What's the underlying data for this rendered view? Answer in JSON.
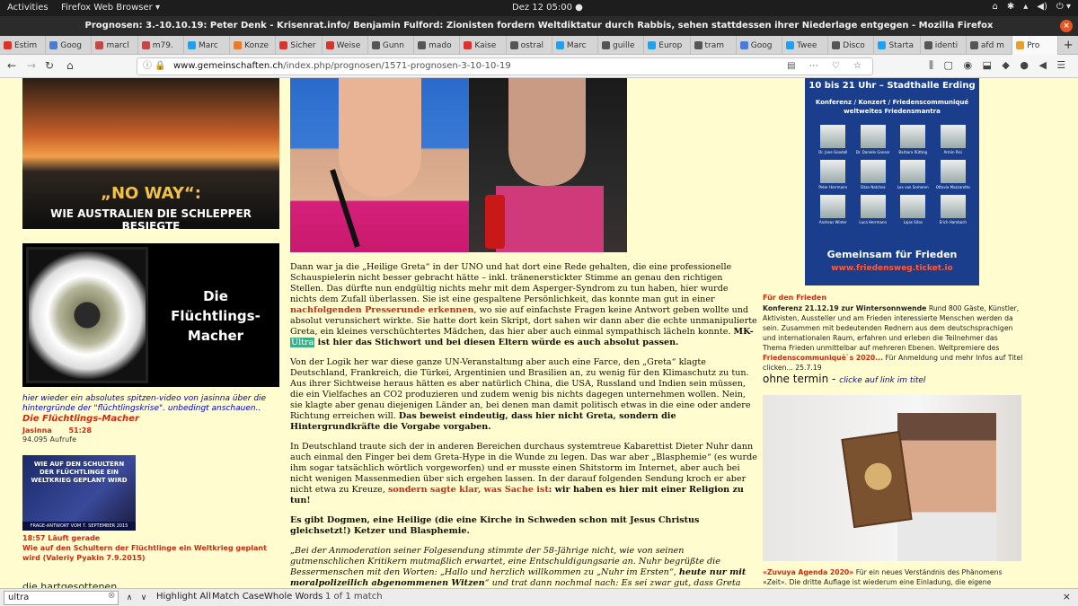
{
  "topbar": {
    "activities": "Activities",
    "app": "Firefox Web Browser ▾",
    "clock": "Dez 12  05:00 ●",
    "tray": [
      "⌂",
      "✱",
      "▴",
      "◀)",
      "⏻ ▾"
    ]
  },
  "window": {
    "title": "Prognosen: 3.-10.10.19: Peter Denk - Krisenrat.info/ Benjamin Fulford: Zionisten fordern Weltdiktatur durch Rabbis, sehen stattdessen ihrer Niederlage entgegen - Mozilla Firefox",
    "close": "×"
  },
  "tabs": [
    {
      "label": "Estim",
      "color": "#d9342b"
    },
    {
      "label": "Goog",
      "color": "#4a7bd8"
    },
    {
      "label": "marcl",
      "color": "#c04848"
    },
    {
      "label": "m79.",
      "color": "#c04848"
    },
    {
      "label": "Marc",
      "color": "#1da1f2"
    },
    {
      "label": "Konze",
      "color": "#e87a2a"
    },
    {
      "label": "Sicher",
      "color": "#d9342b"
    },
    {
      "label": "Weise",
      "color": "#d9342b"
    },
    {
      "label": "Gunn",
      "color": "#555"
    },
    {
      "label": "mado",
      "color": "#555"
    },
    {
      "label": "Kaise",
      "color": "#d9342b"
    },
    {
      "label": "ostral",
      "color": "#555"
    },
    {
      "label": "Marc",
      "color": "#1da1f2"
    },
    {
      "label": "guille",
      "color": "#555"
    },
    {
      "label": "Europ",
      "color": "#1da1f2"
    },
    {
      "label": "tram",
      "color": "#555"
    },
    {
      "label": "Goog",
      "color": "#4a7bd8"
    },
    {
      "label": "Twee",
      "color": "#1da1f2"
    },
    {
      "label": "Disco",
      "color": "#555"
    },
    {
      "label": "Starta",
      "color": "#1da1f2"
    },
    {
      "label": "identi",
      "color": "#555"
    },
    {
      "label": "afd m",
      "color": "#555"
    },
    {
      "label": "Pro",
      "color": "#e8a02a",
      "active": true
    }
  ],
  "nav": {
    "back": "←",
    "forward": "→",
    "reload": "↻",
    "home": "⌂",
    "url_host": "www.gemeinschaften.ch",
    "url_path": "/index.php/prognosen/1571-prognosen-3-10-10-19",
    "url_left_icons": "ⓘ 🔒",
    "url_right_icons": "▤ ⋯ ♡ ☆",
    "right_icons": "⫼ ▢ ◉ ⬓ ◆ ● ◀ ☰"
  },
  "left": {
    "banner1_title": "„NO WAY“:",
    "banner1_sub": "WIE AUSTRALIEN DIE SCHLEPPER BESIEGTE",
    "banner2_title": "Die Flüchtlings-Macher",
    "caption_link": "hier wieder ein absolutes spitzen-video von jasinna über die hintergründe der \"flüchtlingskrise\". unbedingt anschauen..",
    "caption_title": "Die Flüchtlings-Macher",
    "caption_author": "Jasinna",
    "caption_duration": "51:28",
    "caption_views": "94.095 Aufrufe",
    "banner3_text": "WIE AUF DEN SCHULTERN DER FLÜCHTLINGE EIN WELTKRIEG GEPLANT WIRD",
    "banner3_bottom": "FRAGE-ANTWORT VOM 7. SEPTEMBER 2015  VALERIY PYAKIN",
    "video_time": "18:57 Läuft gerade",
    "video_title": "Wie auf den Schultern der Flüchtlinge ein Weltkrieg geplant wird (Valeriy Pyakin 7.9.2015)",
    "more": "die hartgesottenen..."
  },
  "article": {
    "p1_a": "Dann war ja die „Heilige Greta“ in der UNO und hat dort eine Rede gehalten, die eine professionelle Schauspielerin nicht besser gebracht hätte – inkl. tränenerstickter Stimme an genau den richtigen Stellen. Das dürfte nun endgültig nichts mehr mit dem Asperger-Syndrom zu tun haben, hier wurde nichts dem Zufall überlassen. Sie ist eine gespaltene Persönlichkeit, das konnte man gut in einer ",
    "p1_red": "nachfolgenden Presserunde erkennen",
    "p1_b": ", wo sie auf einfachste Fragen keine Antwort geben wollte und absolut verunsichert wirkte. Sie hatte dort kein Skript, dort sahen wir dann aber die echte unmanipulierte Greta, ein kleines verschüchtertes Mädchen, das hier aber auch einmal sympathisch lächeln konnte. ",
    "p1_bold1": "MK-",
    "p1_hl": "Ultra",
    "p1_bold2": " ist hier das Stichwort und bei diesen Eltern würde es auch absolut passen.",
    "p2_a": "Von der Logik her war diese ganze UN-Veranstaltung aber auch eine Farce, den „Greta“ klagte Deutschland, Frankreich, die Türkei, Argentinien und Brasilien an, zu wenig für den Klimaschutz zu tun. Aus ihrer Sichtweise heraus hätten es aber natürlich China, die USA, Russland und Indien sein müssen, die ein Vielfaches an CO2 produzieren und zudem wenig bis nichts dagegen unternehmen wollen. Nein, sie klagte aber genau diejenigen Länder an, bei denen man damit politisch etwas in die eine oder andere Richtung erreichen will. ",
    "p2_bold": "Das beweist eindeutig, dass hier nicht Greta, sondern die Hintergrundkräfte die Vorgabe vorgaben.",
    "p3_a": "In Deutschland traute sich der in anderen Bereichen durchaus systemtreue Kabarettist Dieter Nuhr dann auch einmal den Finger bei dem Greta-Hype in die Wunde zu legen. Das war aber „Blasphemie“ (es wurde ihm sogar tatsächlich wörtlich vorgeworfen) und er musste einen Shitstorm im Internet, aber auch bei nicht wenigen Massenmedien über sich ergehen lassen. In der darauf folgenden Sendung kroch er aber nicht etwa zu Kreuze, ",
    "p3_red": "sondern sagte klar, was Sache ist",
    "p3_bold": ": wir haben es hier mit einer Religion zu tun!",
    "p4_bold": "Es gibt Dogmen, eine Heilige (die eine Kirche in Schweden schon mit Jesus Christus gleichsetzt!) Ketzer und Blasphemie.",
    "p5_a": "„Bei der Anmoderation seiner Folgesendung stimmte der 58-Jährige nicht, wie von seinen gutmenschlichen Kritikern mutmaßlich erwartet, eine Entschuldigungsarie an. Nuhr begrüßte die Bessermenschen mit den Worten: „Hallo und herzlich willkommen zu „Nuhr im Ersten“, ",
    "p5_bold": "heute nur mit moralpolizeilich abgenommenen Witzen",
    "p5_b": "“ und trat dann nochmal nach: Es sei zwar gut, dass Greta das Klima thematisiere. Er jedoch glaube aber, dass ihre Forderungen in ihrer ganzen Radikalität in eine Katastrophe führten. „Was"
  },
  "right": {
    "poster_head": "10 bis 21 Uhr – Stadthalle Erding",
    "poster_sub": "Konferenz / Konzert / Friedenscommuniqué weltweites Friedensmantra",
    "poster_people": [
      "Dr. Jane Goodall",
      "Dr. Daniele Ganser",
      "Barbara Rütting",
      "Armin Risi",
      "Peter Herrmann",
      "Sitan Natchez",
      "Lex van Someren",
      "Ottavia Mazzarotto",
      "Andreas Winter",
      "Luca Herrmann",
      "Lojas Sitas",
      "Erich Hambach"
    ],
    "poster_foot": "Gemeinsam für Frieden",
    "poster_url": "www.friedensweg.ticket.io",
    "event_head": "Für den Frieden",
    "event_bold": "Konferenz 21.12.19 zur Wintersonnwende",
    "event_text": " Rund 800 Gäste, Künstler, Aktivisten, Aussteller und am Frieden interessierte Menschen werden da sein. Zusammen mit bedeutenden Rednern aus dem deutschsprachigen und internationalen Raum, erfahren und erleben die Teilnehmer das Thema Frieden unmittelbar auf mehreren Ebenen. Weltpremiere des ",
    "event_red": "Friedenscommuniquè`s 2020...",
    "event_end": " Für Anmeldung und mehr Infos auf Titel clicken... 25.7.19",
    "termin": "ohne termin - ",
    "termin_link": "clicke auf link im titel",
    "book_title": "«Zuvuya Agenda 2020»",
    "book_text": " Für ein neues Verständnis des Phänomens «Zeit». Die dritte Auflage ist wiederum eine Einladung, die eigene Lebenszeit auf eine"
  },
  "findbar": {
    "query": "ultra",
    "clear": "⊗",
    "prev": "∧",
    "next": "∨",
    "highlight": "Highlight All",
    "match_case": "Match Case",
    "whole_words": "Whole Words",
    "count": "1 of 1 match",
    "close": "×"
  }
}
